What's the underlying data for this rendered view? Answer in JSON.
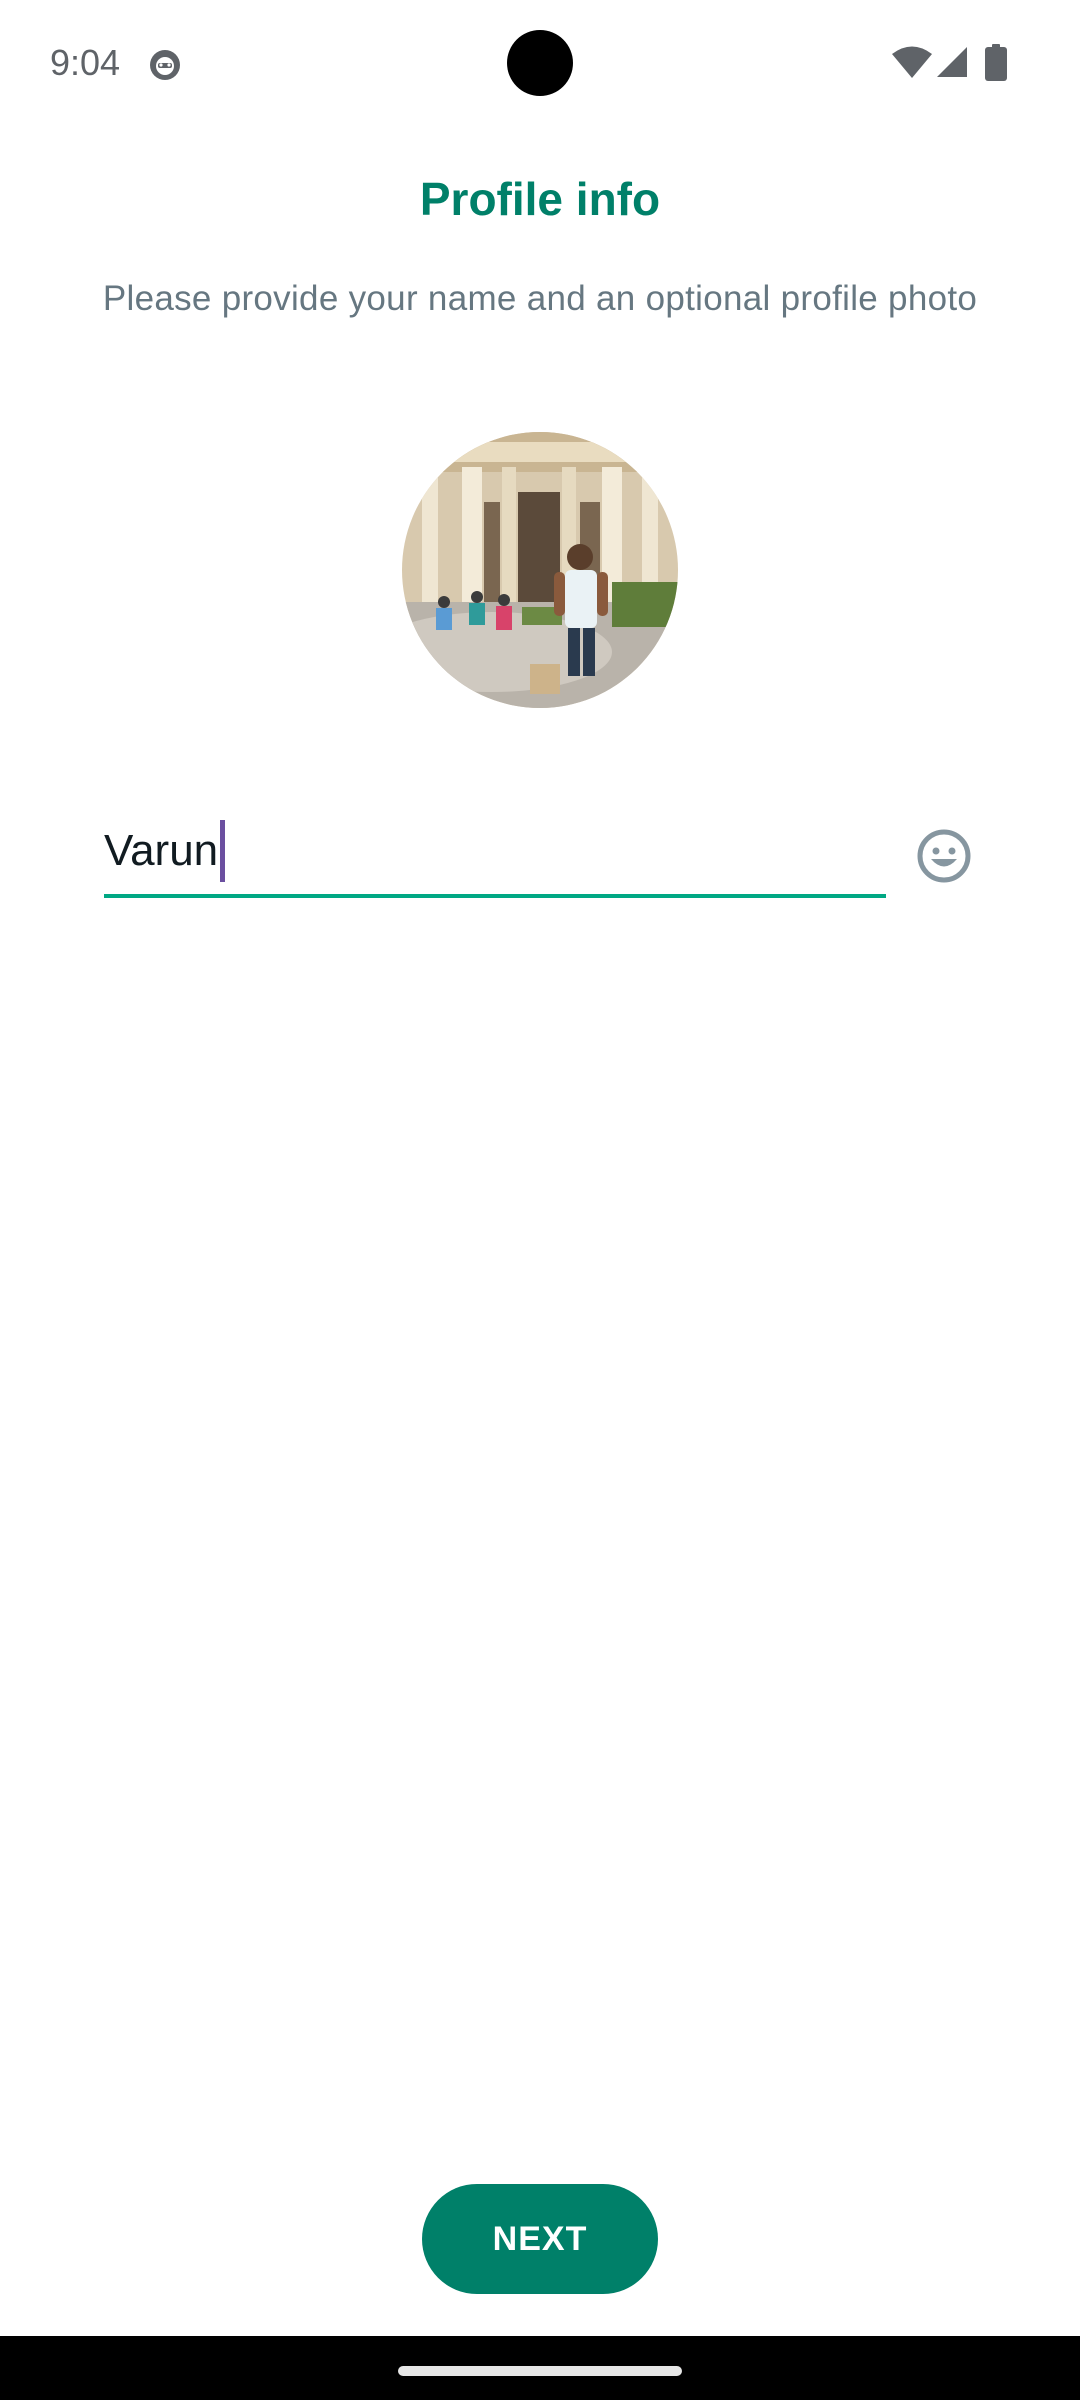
{
  "status_bar": {
    "time": "9:04",
    "icons": [
      "app-notification-icon",
      "wifi-icon",
      "signal-icon",
      "battery-icon"
    ]
  },
  "header": {
    "title": "Profile info",
    "subtitle": "Please provide your name and an optional profile photo"
  },
  "profile": {
    "photo_icon": "profile-photo"
  },
  "name_input": {
    "value": "Varun",
    "emoji_icon": "emoji-icon"
  },
  "actions": {
    "next_label": "NEXT"
  },
  "colors": {
    "accent": "#008069",
    "underline": "#00a884",
    "subtitle": "#667781",
    "cursor": "#6b4fa0"
  }
}
